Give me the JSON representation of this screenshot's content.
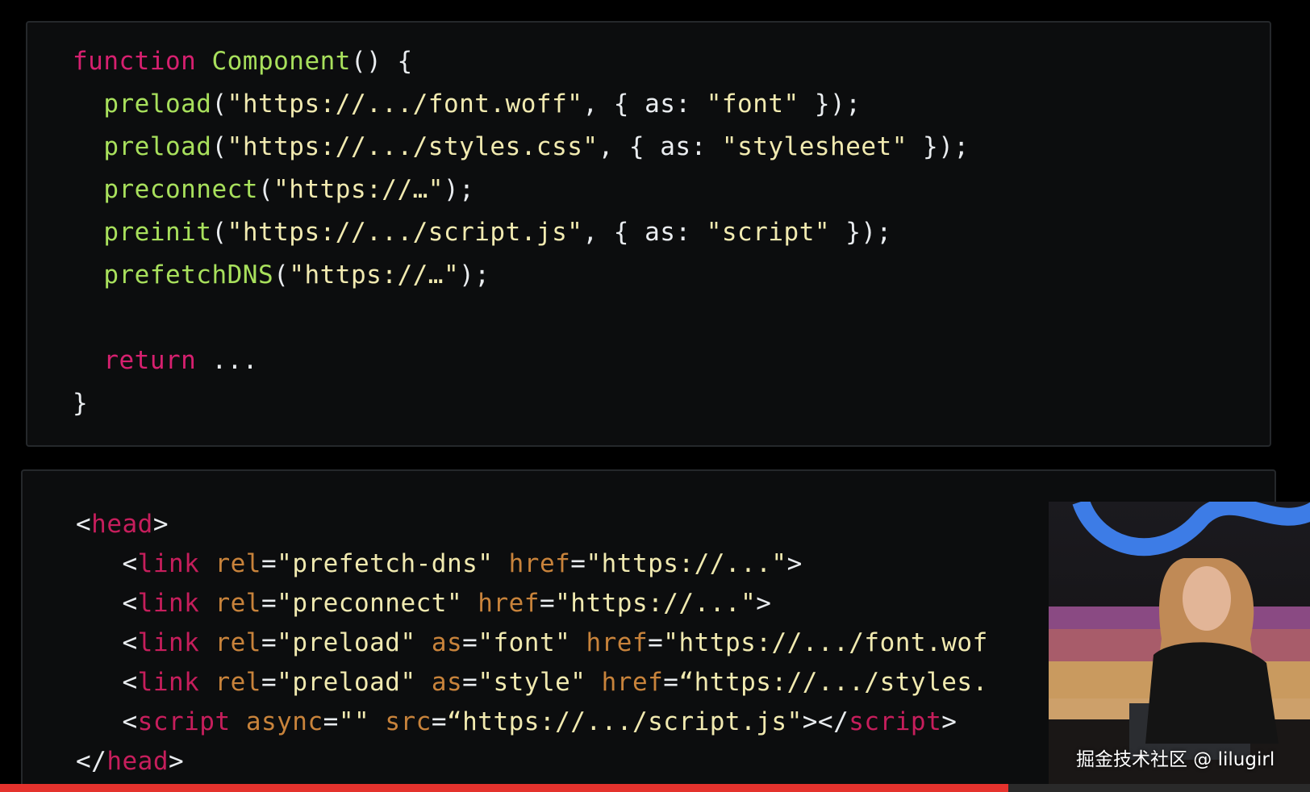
{
  "js_code": {
    "lines": [
      {
        "tokens": [
          {
            "t": "function",
            "c": "kw"
          },
          {
            "t": " ",
            "c": "punc"
          },
          {
            "t": "Component",
            "c": "fn"
          },
          {
            "t": "() {",
            "c": "punc"
          }
        ]
      },
      {
        "tokens": [
          {
            "t": "  ",
            "c": "punc"
          },
          {
            "t": "preload",
            "c": "fn"
          },
          {
            "t": "(",
            "c": "punc"
          },
          {
            "t": "\"https://.../font.woff\"",
            "c": "str"
          },
          {
            "t": ", { as: ",
            "c": "punc"
          },
          {
            "t": "\"font\"",
            "c": "str"
          },
          {
            "t": " });",
            "c": "punc"
          }
        ]
      },
      {
        "tokens": [
          {
            "t": "  ",
            "c": "punc"
          },
          {
            "t": "preload",
            "c": "fn"
          },
          {
            "t": "(",
            "c": "punc"
          },
          {
            "t": "\"https://.../styles.css\"",
            "c": "str"
          },
          {
            "t": ", { as: ",
            "c": "punc"
          },
          {
            "t": "\"stylesheet\"",
            "c": "str"
          },
          {
            "t": " });",
            "c": "punc"
          }
        ]
      },
      {
        "tokens": [
          {
            "t": "  ",
            "c": "punc"
          },
          {
            "t": "preconnect",
            "c": "fn"
          },
          {
            "t": "(",
            "c": "punc"
          },
          {
            "t": "\"https://…\"",
            "c": "str"
          },
          {
            "t": ");",
            "c": "punc"
          }
        ]
      },
      {
        "tokens": [
          {
            "t": "  ",
            "c": "punc"
          },
          {
            "t": "preinit",
            "c": "fn"
          },
          {
            "t": "(",
            "c": "punc"
          },
          {
            "t": "\"https://.../script.js\"",
            "c": "str"
          },
          {
            "t": ", { as: ",
            "c": "punc"
          },
          {
            "t": "\"script\"",
            "c": "str"
          },
          {
            "t": " });",
            "c": "punc"
          }
        ]
      },
      {
        "tokens": [
          {
            "t": "  ",
            "c": "punc"
          },
          {
            "t": "prefetchDNS",
            "c": "fn"
          },
          {
            "t": "(",
            "c": "punc"
          },
          {
            "t": "\"https://…\"",
            "c": "str"
          },
          {
            "t": ");",
            "c": "punc"
          }
        ]
      },
      {
        "tokens": [
          {
            "t": " ",
            "c": "punc"
          }
        ]
      },
      {
        "tokens": [
          {
            "t": "  ",
            "c": "punc"
          },
          {
            "t": "return",
            "c": "kw"
          },
          {
            "t": " ...",
            "c": "punc"
          }
        ]
      },
      {
        "tokens": [
          {
            "t": "}",
            "c": "punc"
          }
        ]
      }
    ]
  },
  "html_code": {
    "lines": [
      {
        "tokens": [
          {
            "t": "<",
            "c": "punc"
          },
          {
            "t": "head",
            "c": "tag"
          },
          {
            "t": ">",
            "c": "punc"
          }
        ]
      },
      {
        "tokens": [
          {
            "t": "   <",
            "c": "punc"
          },
          {
            "t": "link",
            "c": "tag"
          },
          {
            "t": " ",
            "c": "punc"
          },
          {
            "t": "rel",
            "c": "attr"
          },
          {
            "t": "=",
            "c": "punc"
          },
          {
            "t": "\"prefetch-dns\"",
            "c": "str"
          },
          {
            "t": " ",
            "c": "punc"
          },
          {
            "t": "href",
            "c": "attr"
          },
          {
            "t": "=",
            "c": "punc"
          },
          {
            "t": "\"https://...\"",
            "c": "str"
          },
          {
            "t": ">",
            "c": "punc"
          }
        ]
      },
      {
        "tokens": [
          {
            "t": "   <",
            "c": "punc"
          },
          {
            "t": "link",
            "c": "tag"
          },
          {
            "t": " ",
            "c": "punc"
          },
          {
            "t": "rel",
            "c": "attr"
          },
          {
            "t": "=",
            "c": "punc"
          },
          {
            "t": "\"preconnect\"",
            "c": "str"
          },
          {
            "t": " ",
            "c": "punc"
          },
          {
            "t": "href",
            "c": "attr"
          },
          {
            "t": "=",
            "c": "punc"
          },
          {
            "t": "\"https://...\"",
            "c": "str"
          },
          {
            "t": ">",
            "c": "punc"
          }
        ]
      },
      {
        "tokens": [
          {
            "t": "   <",
            "c": "punc"
          },
          {
            "t": "link",
            "c": "tag"
          },
          {
            "t": " ",
            "c": "punc"
          },
          {
            "t": "rel",
            "c": "attr"
          },
          {
            "t": "=",
            "c": "punc"
          },
          {
            "t": "\"preload\"",
            "c": "str"
          },
          {
            "t": " ",
            "c": "punc"
          },
          {
            "t": "as",
            "c": "attr"
          },
          {
            "t": "=",
            "c": "punc"
          },
          {
            "t": "\"font\"",
            "c": "str"
          },
          {
            "t": " ",
            "c": "punc"
          },
          {
            "t": "href",
            "c": "attr"
          },
          {
            "t": "=",
            "c": "punc"
          },
          {
            "t": "\"https://.../font.wof",
            "c": "str"
          }
        ]
      },
      {
        "tokens": [
          {
            "t": "   <",
            "c": "punc"
          },
          {
            "t": "link",
            "c": "tag"
          },
          {
            "t": " ",
            "c": "punc"
          },
          {
            "t": "rel",
            "c": "attr"
          },
          {
            "t": "=",
            "c": "punc"
          },
          {
            "t": "\"preload\"",
            "c": "str"
          },
          {
            "t": " ",
            "c": "punc"
          },
          {
            "t": "as",
            "c": "attr"
          },
          {
            "t": "=",
            "c": "punc"
          },
          {
            "t": "\"style\"",
            "c": "str"
          },
          {
            "t": " ",
            "c": "punc"
          },
          {
            "t": "href",
            "c": "attr"
          },
          {
            "t": "=",
            "c": "punc"
          },
          {
            "t": "“https://.../styles.",
            "c": "str"
          }
        ]
      },
      {
        "tokens": [
          {
            "t": "   <",
            "c": "punc"
          },
          {
            "t": "script",
            "c": "tag"
          },
          {
            "t": " ",
            "c": "punc"
          },
          {
            "t": "async",
            "c": "attr"
          },
          {
            "t": "=",
            "c": "punc"
          },
          {
            "t": "\"\"",
            "c": "str"
          },
          {
            "t": " ",
            "c": "punc"
          },
          {
            "t": "src",
            "c": "attr"
          },
          {
            "t": "=",
            "c": "punc"
          },
          {
            "t": "“https://.../script.js\"",
            "c": "str"
          },
          {
            "t": "></",
            "c": "punc"
          },
          {
            "t": "script",
            "c": "tag"
          },
          {
            "t": ">",
            "c": "punc"
          }
        ]
      },
      {
        "tokens": [
          {
            "t": "</",
            "c": "punc"
          },
          {
            "t": "head",
            "c": "tag"
          },
          {
            "t": ">",
            "c": "punc"
          }
        ]
      }
    ]
  },
  "watermark": {
    "text": "掘金技术社区 @ lilugirl"
  },
  "video": {
    "progress": 0.77
  },
  "colors": {
    "keyword": "#d6206f",
    "function": "#a8e05c",
    "string": "#f1eab0",
    "tag": "#c61e5c",
    "attribute": "#c8833b",
    "progress": "#e5322d"
  }
}
